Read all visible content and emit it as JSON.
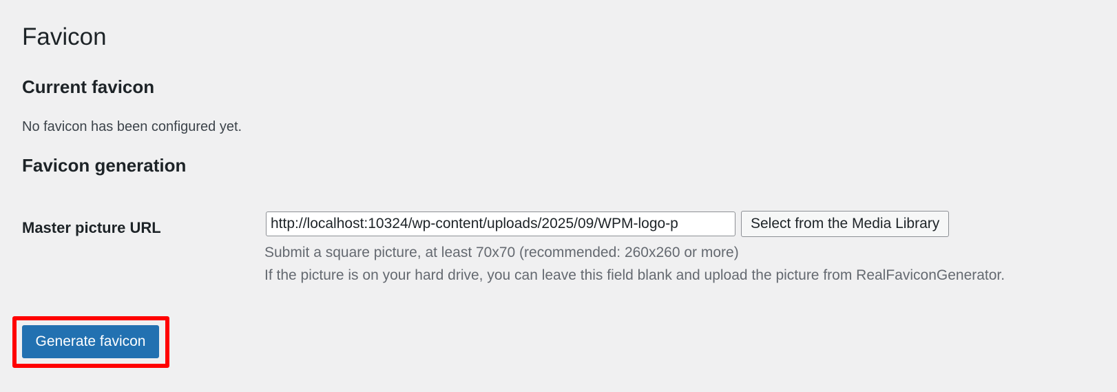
{
  "page": {
    "title": "Favicon"
  },
  "current_section": {
    "heading": "Current favicon",
    "status": "No favicon has been configured yet."
  },
  "generation_section": {
    "heading": "Favicon generation",
    "master_picture": {
      "label": "Master picture URL",
      "value": "http://localhost:10324/wp-content/uploads/2025/09/WPM-logo-p",
      "media_button_label": "Select from the Media Library",
      "hint_size": "Submit a square picture, at least 70x70 (recommended: 260x260 or more)",
      "hint_upload": "If the picture is on your hard drive, you can leave this field blank and upload the picture from RealFaviconGenerator."
    }
  },
  "actions": {
    "generate_label": "Generate favicon"
  },
  "colors": {
    "background": "#f0f0f1",
    "primary": "#2271b1",
    "highlight": "#ff0000"
  }
}
